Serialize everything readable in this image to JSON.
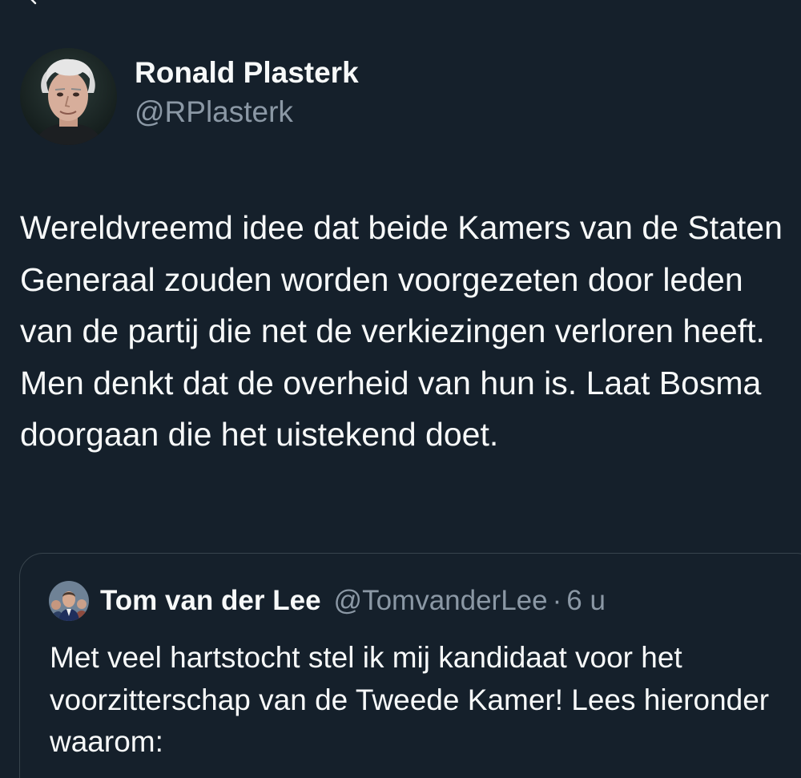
{
  "tweet": {
    "author": {
      "name": "Ronald Plasterk",
      "handle": "@RPlasterk"
    },
    "text": "Wereldvreemd idee dat beide Kamers van de Staten Generaal zouden worden voorgezeten door leden van de partij die net de verkiezingen verloren heeft. Men denkt dat de overheid van hun is. Laat Bosma doorgaan die het uistekend doet."
  },
  "quoted_tweet": {
    "author": {
      "name": "Tom van der Lee",
      "handle": "@TomvanderLee"
    },
    "separator": "·",
    "time": "6 u",
    "text": "Met veel hartstocht stel ik mij kandidaat voor het voorzitterschap van de Tweede Kamer! Lees hieronder waarom:"
  },
  "icons": {
    "back": "chevron-back-icon"
  },
  "colors": {
    "background": "#15202b",
    "text_primary": "#f7f9f9",
    "text_secondary": "#8b98a5",
    "border": "#38444d"
  }
}
